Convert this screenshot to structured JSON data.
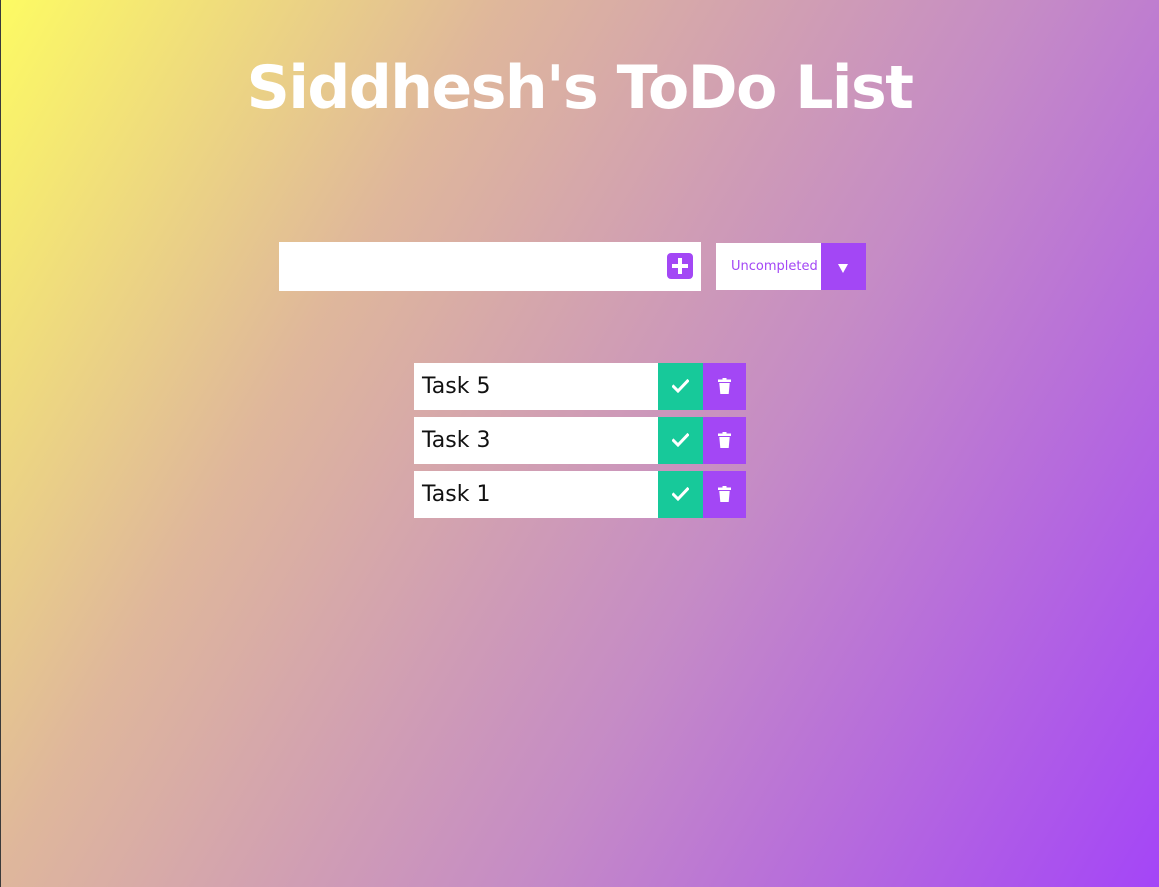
{
  "header": {
    "title": "Siddhesh's ToDo List"
  },
  "form": {
    "input_value": "",
    "input_placeholder": "",
    "add_icon": "plus-square-icon",
    "filter": {
      "selected": "Uncompleted",
      "arrow_icon": "triangle-down-icon"
    }
  },
  "todos": [
    {
      "text": "Task 5",
      "complete_icon": "check-icon",
      "delete_icon": "trash-icon"
    },
    {
      "text": "Task 3",
      "complete_icon": "check-icon",
      "delete_icon": "trash-icon"
    },
    {
      "text": "Task 1",
      "complete_icon": "check-icon",
      "delete_icon": "trash-icon"
    }
  ],
  "colors": {
    "accent": "#a347f5",
    "complete": "#17c99a",
    "gradient_start": "#fdfb63",
    "gradient_end": "#a445f7",
    "title": "#ffffff"
  }
}
